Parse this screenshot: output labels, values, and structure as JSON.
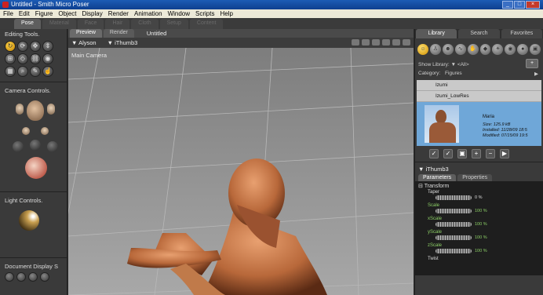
{
  "window": {
    "title": "Untitled - Smith Micro Poser",
    "controls": [
      "_",
      "□",
      "×"
    ]
  },
  "menu": [
    "File",
    "Edit",
    "Figure",
    "Object",
    "Display",
    "Render",
    "Animation",
    "Window",
    "Scripts",
    "Help"
  ],
  "rooms": [
    {
      "label": "Pose",
      "active": true
    },
    {
      "label": "Material"
    },
    {
      "label": "Face"
    },
    {
      "label": "Hair"
    },
    {
      "label": "Cloth"
    },
    {
      "label": "Setup"
    },
    {
      "label": "Content"
    }
  ],
  "left": {
    "editing_title": "Editing Tools.",
    "camera_title": "Camera Controls.",
    "light_title": "Light Controls.",
    "document_title": "Document Display S"
  },
  "viewport": {
    "tabs": [
      "Preview",
      "Render"
    ],
    "doc_title": "Untitled",
    "figure_select": "Alyson",
    "actor_select": "iThumb3",
    "camera_label": "Main Camera"
  },
  "library": {
    "tabs": [
      "Library",
      "Search",
      "Favorites"
    ],
    "show_label": "Show Library:",
    "show_value": "<All>",
    "category_label": "Category:",
    "category_value": "Figures",
    "items": [
      "Izumi",
      "Izumi_LowRes"
    ],
    "selected": {
      "name": "Maria",
      "size_label": "Size:",
      "size_value": "125.9 kB",
      "installed_label": "Installed:",
      "installed_value": "11/28/09 18:5",
      "modified_label": "Modified:",
      "modified_value": "07/15/09 19:5"
    },
    "buttons": [
      "✓",
      "✓",
      "▣",
      "+",
      "−",
      "▶"
    ]
  },
  "params": {
    "header": "iThumb3",
    "tabs": [
      "Parameters",
      "Properties"
    ],
    "section": "Transform",
    "rows": [
      {
        "label": "Taper",
        "value": "0 %",
        "white": true
      },
      {
        "label": "Scale",
        "value": "100 %"
      },
      {
        "label": "xScale",
        "value": "100 %"
      },
      {
        "label": "yScale",
        "value": "100 %"
      },
      {
        "label": "zScale",
        "value": "100 %"
      },
      {
        "label": "Twist",
        "value": ""
      }
    ]
  }
}
